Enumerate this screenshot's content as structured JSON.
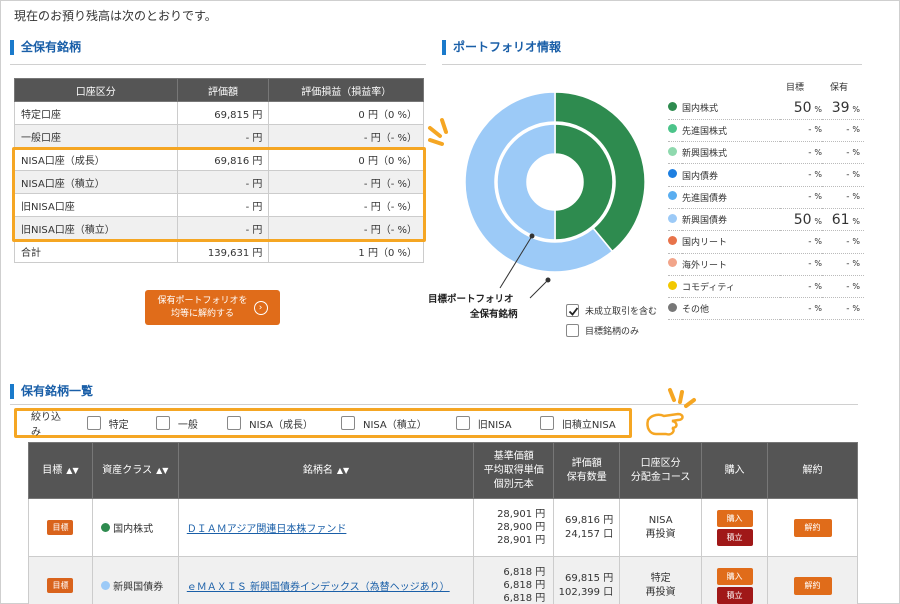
{
  "intro_text": "現在のお預り残高は次のとおりです。",
  "holdings_section": {
    "title": "全保有銘柄",
    "headers": [
      "口座区分",
      "評価額",
      "評価損益（損益率）"
    ],
    "rows": [
      {
        "account": "特定口座",
        "value": "69,815 円",
        "pl": "0 円（0 %）"
      },
      {
        "account": "一般口座",
        "value": "- 円",
        "pl": "- 円（- %）"
      },
      {
        "account": "NISA口座（成長）",
        "value": "69,816 円",
        "pl": "0 円（0 %）"
      },
      {
        "account": "NISA口座（積立）",
        "value": "- 円",
        "pl": "- 円（- %）"
      },
      {
        "account": "旧NISA口座",
        "value": "- 円",
        "pl": "- 円（- %）"
      },
      {
        "account": "旧NISA口座（積立）",
        "value": "- 円",
        "pl": "- 円（- %）"
      },
      {
        "account": "合計",
        "value": "139,631 円",
        "pl": "1 円（0 %）"
      }
    ],
    "cancel_button_line1": "保有ポートフォリオを",
    "cancel_button_line2": "均等に解約する",
    "cancel_button_icon": "chevron-right-circle-icon"
  },
  "portfolio": {
    "title": "ポートフォリオ情報",
    "col_target": "目標",
    "col_held": "保有",
    "chart_label_target": "目標ポートフォリオ",
    "chart_label_held": "全保有銘柄",
    "option_unsettled": "未成立取引を含む",
    "option_target_only": "目標銘柄のみ",
    "assets": [
      {
        "name": "国内株式",
        "color": "#2e8b4f",
        "target": "50",
        "held": "39"
      },
      {
        "name": "先進国株式",
        "color": "#4cc48a",
        "target": "-",
        "held": "-"
      },
      {
        "name": "新興国株式",
        "color": "#8fd9ae",
        "target": "-",
        "held": "-"
      },
      {
        "name": "国内債券",
        "color": "#1e7fe0",
        "target": "-",
        "held": "-"
      },
      {
        "name": "先進国債券",
        "color": "#5aaef0",
        "target": "-",
        "held": "-"
      },
      {
        "name": "新興国債券",
        "color": "#9ccaf7",
        "target": "50",
        "held": "61"
      },
      {
        "name": "国内リート",
        "color": "#e8734a",
        "target": "-",
        "held": "-"
      },
      {
        "name": "海外リート",
        "color": "#f2a58a",
        "target": "-",
        "held": "-"
      },
      {
        "name": "コモディティ",
        "color": "#f2c800",
        "target": "-",
        "held": "-"
      },
      {
        "name": "その他",
        "color": "#777777",
        "target": "-",
        "held": "-"
      }
    ],
    "pct_unit": "%"
  },
  "list": {
    "title": "保有銘柄一覧",
    "filter_label": "絞り込み",
    "filters": [
      "特定",
      "一般",
      "NISA（成長）",
      "NISA（積立）",
      "旧NISA",
      "旧積立NISA"
    ],
    "headers": {
      "target": "目標",
      "asset_class": "資産クラス",
      "fund_name": "銘柄名",
      "price1": "基準価額",
      "price2": "平均取得単価",
      "price3": "個別元本",
      "value1": "評価額",
      "value2": "保有数量",
      "account1": "口座区分",
      "account2": "分配金コース",
      "buy": "購入",
      "sell": "解約"
    },
    "rows": [
      {
        "tag": "目標",
        "asset_color": "#2e8b4f",
        "asset_class": "国内株式",
        "fund": "ＤＩＡＭアジア関連日本株ファンド",
        "prices": [
          "28,901 円",
          "28,900 円",
          "28,901 円"
        ],
        "value": "69,816 円",
        "qty": "24,157 口",
        "account": "NISA",
        "course": "再投資",
        "buy_label": "購入",
        "tsumi_label": "積立",
        "sell_label": "解約"
      },
      {
        "tag": "目標",
        "asset_color": "#9ccaf7",
        "asset_class": "新興国債券",
        "fund": "ｅＭＡＸＩＳ 新興国債券インデックス（為替ヘッジあり）",
        "prices": [
          "6,818 円",
          "6,818 円",
          "6,818 円"
        ],
        "value": "69,815 円",
        "qty": "102,399 口",
        "account": "特定",
        "course": "再投資",
        "buy_label": "購入",
        "tsumi_label": "積立",
        "sell_label": "解約"
      }
    ]
  }
}
